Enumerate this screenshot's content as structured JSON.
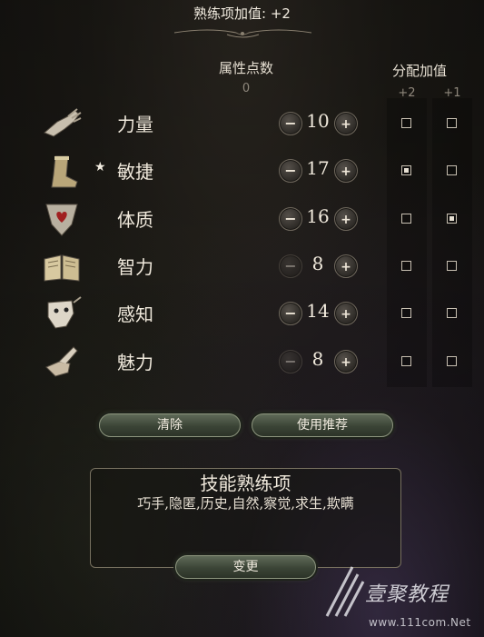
{
  "header": {
    "title": "熟练项加值: +2"
  },
  "columns": {
    "points_label": "属性点数",
    "points_value": "0",
    "alloc_label": "分配加值",
    "alloc_plus2": "+2",
    "alloc_plus1": "+1"
  },
  "attributes": [
    {
      "name": "力量",
      "value": "10",
      "icon": "gauntlet-icon",
      "star": "",
      "minus_enabled": true,
      "plus2": false,
      "plus1": false
    },
    {
      "name": "敏捷",
      "value": "17",
      "icon": "boot-icon",
      "star": "★",
      "minus_enabled": true,
      "plus2": true,
      "plus1": false
    },
    {
      "name": "体质",
      "value": "16",
      "icon": "heart-shield-icon",
      "star": "",
      "minus_enabled": true,
      "plus2": false,
      "plus1": true
    },
    {
      "name": "智力",
      "value": "8",
      "icon": "open-book-icon",
      "star": "",
      "minus_enabled": false,
      "plus2": false,
      "plus1": false
    },
    {
      "name": "感知",
      "value": "14",
      "icon": "mask-icon",
      "star": "",
      "minus_enabled": true,
      "plus2": false,
      "plus1": false
    },
    {
      "name": "魅力",
      "value": "8",
      "icon": "feathered-hand-icon",
      "star": "",
      "minus_enabled": false,
      "plus2": false,
      "plus1": false
    }
  ],
  "stepper": {
    "minus": "−",
    "plus": "+"
  },
  "buttons": {
    "clear": "清除",
    "recommend": "使用推荐",
    "change": "变更"
  },
  "skills": {
    "title": "技能熟练项",
    "list": "巧手,隐匿,历史,自然,察觉,求生,欺瞒"
  },
  "watermark": {
    "name": "壹聚教程",
    "url": "www.111com.Net"
  },
  "colors": {
    "accent_green": "#3b4436",
    "text": "#e6dfd2"
  }
}
